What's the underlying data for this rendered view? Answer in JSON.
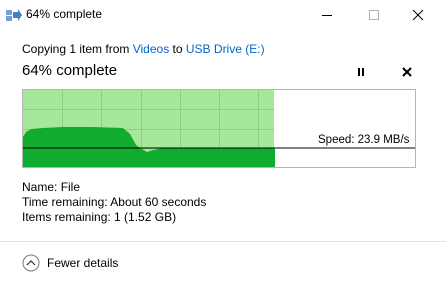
{
  "window": {
    "title": "64% complete",
    "icon": "copy-arrows-icon"
  },
  "copy": {
    "prefix": "Copying 1 item from ",
    "source": "Videos",
    "middle": " to ",
    "destination": "USB Drive (E:)"
  },
  "progress": {
    "heading": "64% complete",
    "percent": 64
  },
  "graph": {
    "speed_label": "Speed: 23.9 MB/s",
    "colors": {
      "progress_fill": "#a6e79b",
      "speed_fill": "#10ac2f",
      "grid": "#8bcf80",
      "speed_line": "#000000"
    }
  },
  "details": {
    "name_label": "Name:",
    "name_value": "File",
    "time_label": "Time remaining:",
    "time_value": "About 60 seconds",
    "items_label": "Items remaining:",
    "items_value": "1 (1.52 GB)"
  },
  "footer": {
    "toggle_label": "Fewer details"
  }
}
